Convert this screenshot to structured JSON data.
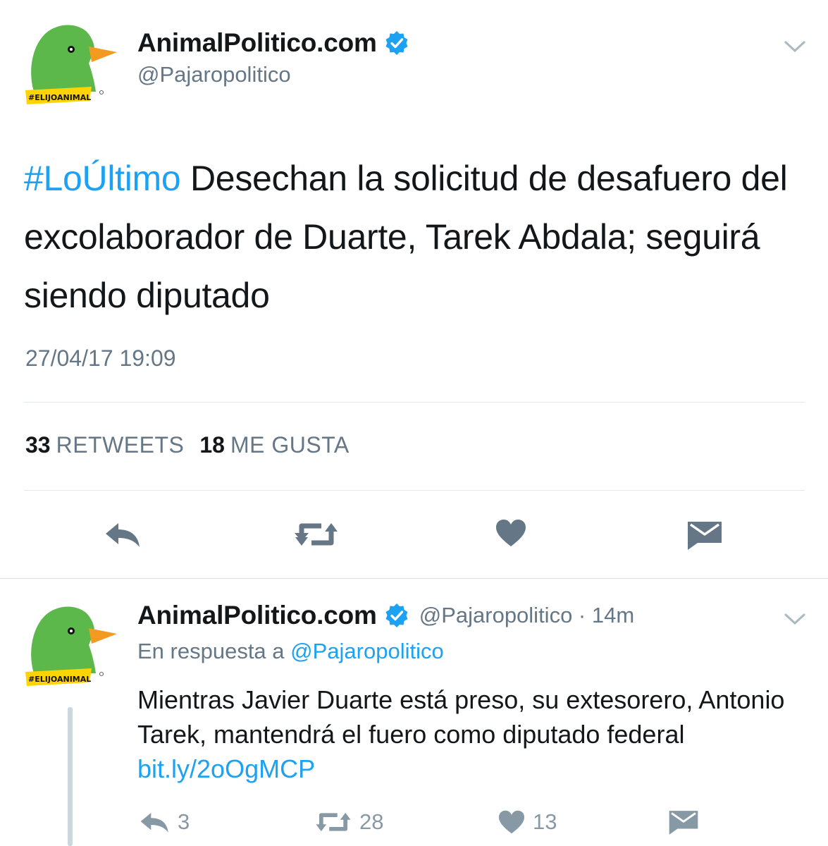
{
  "main_tweet": {
    "display_name": "AnimalPolitico.com",
    "handle": "@Pajaropolitico",
    "avatar_badge": "#ELIJOANIMAL",
    "hashtag": "#LoÚltimo",
    "text": " Desechan la solicitud de desafuero del excolaborador de Duarte, Tarek Abdala; seguirá siendo diputado",
    "timestamp": "27/04/17 19:09",
    "retweets_count": "33",
    "retweets_label": "RETWEETS",
    "likes_count": "18",
    "likes_label": "ME GUSTA",
    "actions": [
      "reply-icon",
      "retweet-icon",
      "heart-icon",
      "envelope-icon"
    ]
  },
  "reply_tweet": {
    "display_name": "AnimalPolitico.com",
    "handle_time": "@Pajaropolitico · 14m",
    "in_reply_prefix": "En respuesta a ",
    "in_reply_mention": "@Pajaropolitico",
    "avatar_badge": "#ELIJOANIMAL",
    "text": "Mientras Javier Duarte está preso, su extesorero, Antonio Tarek, mantendrá el fuero como diputado federal ",
    "link": "bit.ly/2oOgMCP",
    "reply_count": "3",
    "retweet_count": "28",
    "like_count": "13"
  },
  "colors": {
    "accent": "#1da1f2",
    "secondary_text": "#657786",
    "icon_gray": "#8899a6",
    "avatar_green": "#5cb84a",
    "beak_orange": "#f39a21",
    "badge_yellow": "#ffd400"
  }
}
